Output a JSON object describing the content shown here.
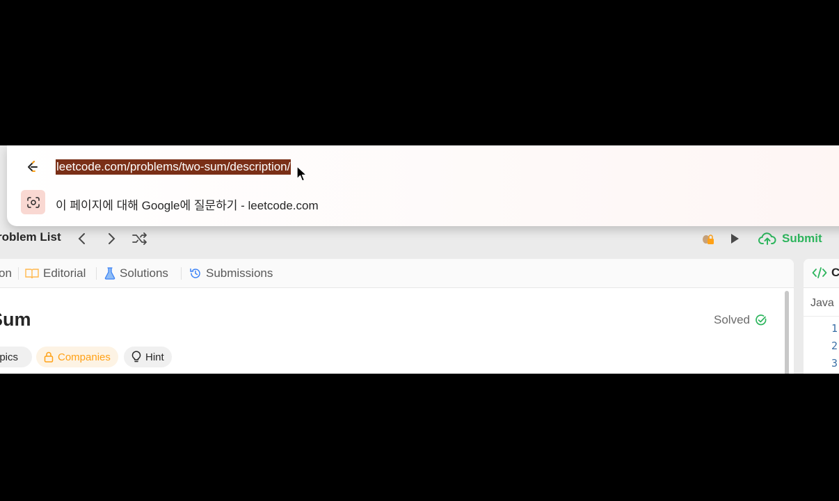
{
  "omnibox": {
    "url": "leetcode.com/problems/two-sum/description/",
    "suggestion": "이 페이지에 대해 Google에 질문하기 - leetcode.com",
    "favicon": "leetcode-logo-icon",
    "lens_icon": "google-lens-icon"
  },
  "navbar": {
    "title": "roblem List",
    "submit_label": "Submit",
    "accent": "#2db55d"
  },
  "tabs": [
    {
      "label": "on"
    },
    {
      "label": "Editorial",
      "icon": "book-icon"
    },
    {
      "label": "Solutions",
      "icon": "flask-icon"
    },
    {
      "label": "Submissions",
      "icon": "history-icon"
    }
  ],
  "problem": {
    "title": "Sum",
    "status": "Solved",
    "chips": {
      "topics": "opics",
      "companies": "Companies",
      "hint": "Hint"
    }
  },
  "code_panel": {
    "tab_label": "Co",
    "language": "Java",
    "line_numbers": [
      "1",
      "2",
      "3"
    ]
  }
}
